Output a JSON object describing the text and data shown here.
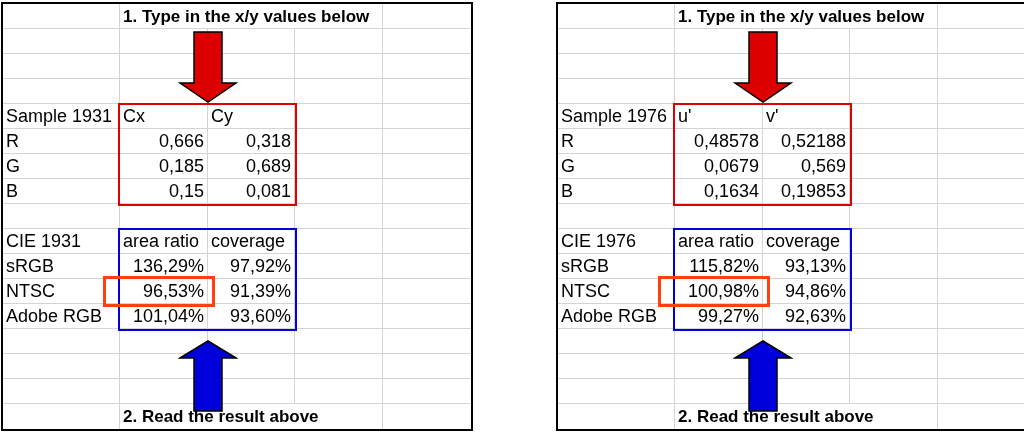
{
  "panels": [
    {
      "instruction": "1. Type in the x/y values below",
      "input_table": {
        "columns": [
          "Sample 1931",
          "Cx",
          "Cy"
        ],
        "rows": [
          {
            "label": "R",
            "values": [
              "0,666",
              "0,318"
            ]
          },
          {
            "label": "G",
            "values": [
              "0,185",
              "0,689"
            ]
          },
          {
            "label": "B",
            "values": [
              "0,15",
              "0,081"
            ]
          }
        ]
      },
      "result_table": {
        "columns": [
          "CIE 1931",
          "area ratio",
          "coverage"
        ],
        "rows": [
          {
            "label": "sRGB",
            "values": [
              "136,29%",
              "97,92%"
            ],
            "highlighted": false
          },
          {
            "label": "NTSC",
            "values": [
              "96,53%",
              "91,39%"
            ],
            "highlighted": true
          },
          {
            "label": "Adobe RGB",
            "values": [
              "101,04%",
              "93,60%"
            ],
            "highlighted": false
          }
        ]
      },
      "footer": "2. Read the result above"
    },
    {
      "instruction": "1. Type in the x/y values below",
      "input_table": {
        "columns": [
          "Sample 1976",
          "u'",
          "v'"
        ],
        "rows": [
          {
            "label": "R",
            "values": [
              "0,48578",
              "0,52188"
            ]
          },
          {
            "label": "G",
            "values": [
              "0,0679",
              "0,569"
            ]
          },
          {
            "label": "B",
            "values": [
              "0,1634",
              "0,19853"
            ]
          }
        ]
      },
      "result_table": {
        "columns": [
          "CIE 1976",
          "area ratio",
          "coverage"
        ],
        "rows": [
          {
            "label": "sRGB",
            "values": [
              "115,82%",
              "93,13%"
            ],
            "highlighted": false
          },
          {
            "label": "NTSC",
            "values": [
              "100,98%",
              "94,86%"
            ],
            "highlighted": true
          },
          {
            "label": "Adobe RGB",
            "values": [
              "99,27%",
              "92,63%"
            ],
            "highlighted": false
          }
        ]
      },
      "footer": "2. Read the result above"
    }
  ]
}
